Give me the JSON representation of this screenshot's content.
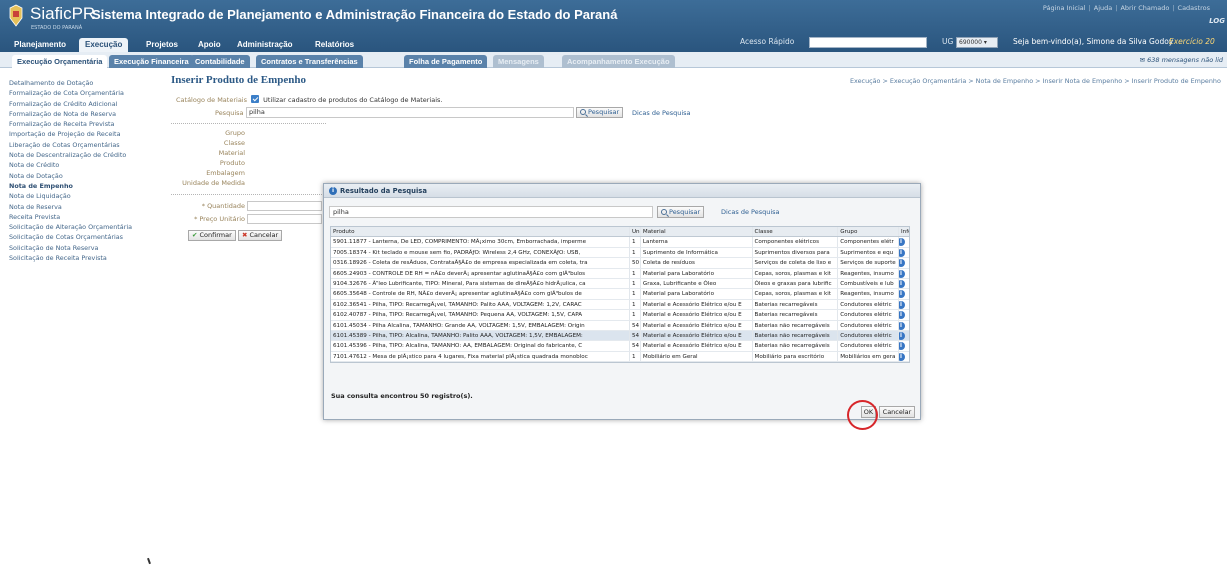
{
  "header": {
    "brand": "SiaficPR",
    "brand_sub": "ESTADO DO PARANÁ",
    "system_title": "Sistema Integrado de Planejamento e Administração Financeira do Estado do Paraná",
    "top_links": [
      "Página Inicial",
      "Ajuda",
      "Abrir Chamado",
      "Cadastros"
    ],
    "corner_logo": "LOG",
    "quick_access_label": "Acesso Rápido",
    "ug_label": "UG",
    "ug_value": "690000",
    "welcome": "Seja bem-vindo(a), Simone da Silva Godoy",
    "exercise": "Exercício 20"
  },
  "menu": {
    "items": [
      "Planejamento",
      "Execução",
      "Projetos",
      "Apoio",
      "Administração",
      "Relatórios"
    ]
  },
  "submenu": {
    "items": [
      "Execução Orçamentária",
      "Execução Financeira",
      "Contabilidade",
      "Contratos e Transferências",
      "Folha de Pagamento",
      "Mensagens",
      "Acompanhamento Execução"
    ],
    "messages": "638 mensagens não lid"
  },
  "sidebar": {
    "items": [
      "Detalhamento de Dotação",
      "Formalização de Cota Orçamentária",
      "Formalização de Crédito Adicional",
      "Formalização de Nota de Reserva",
      "Formalização de Receita Prevista",
      "Importação de Projeção de Receita",
      "Liberação de Cotas Orçamentárias",
      "Nota de Descentralização de Crédito",
      "Nota de Crédito",
      "Nota de Dotação",
      "Nota de Empenho",
      "Nota de Liquidação",
      "Nota de Reserva",
      "Receita Prevista",
      "Solicitação de Alteração Orçamentária",
      "Solicitação de Cotas Orçamentárias",
      "Solicitação de Nota Reserva",
      "Solicitação de Receita Prevista"
    ]
  },
  "main": {
    "title": "Inserir Produto de Empenho",
    "breadcrumb": "Execução > Execução Orçamentária > Nota de Empenho > Inserir Nota de Empenho > Inserir Produto de Empenho",
    "catalog_label": "Catálogo de Materiais",
    "catalog_text": "Utilizar cadastro de produtos do Catálogo de Materiais.",
    "search_label": "Pesquisa",
    "search_value": "pilha",
    "search_button": "Pesquisar",
    "search_tips": "Dicas de Pesquisa",
    "fields": [
      "Grupo",
      "Classe",
      "Material",
      "Produto",
      "Embalagem",
      "Unidade de Medida"
    ],
    "quantity_label": "* Quantidade",
    "unit_price_label": "* Preço Unitário",
    "confirm": "Confirmar",
    "cancel": "Cancelar"
  },
  "modal": {
    "title": "Resultado da Pesquisa",
    "search_value": "pilha",
    "search_button": "Pesquisar",
    "search_tips": "Dicas de Pesquisa",
    "columns": [
      "Produto",
      "Und.",
      "Material",
      "Classe",
      "Grupo",
      "Info"
    ],
    "rows": [
      [
        "5901.11877 - Lanterna, De LED, COMPRIMENTO: MÃ¡ximo 30cm, Emborrachada, imperme",
        "1",
        "Lanterna",
        "Componentes elétricos",
        "Componentes elétr"
      ],
      [
        "7005.18374 - Kit teclado e mouse sem fio, PADRÃƒO: Wireless 2,4 GHz, CONEXÃƒO: USB,",
        "1",
        "Suprimento de Informática",
        "Suprimentos diversos para",
        "Suprimentos e equ"
      ],
      [
        "0316.18926 - Coleta de resÃ­duos, ContrataÃ§Ã£o de empresa especializada em coleta, tra",
        "50",
        "Coleta de resíduos",
        "Serviços de coleta de lixo e",
        "Serviços de suporte"
      ],
      [
        "6605.24903 - CONTROLE DE RH = nÃ£o deverÃ¡ apresentar aglutinaÃ§Ã£o com glÃ³bulos",
        "1",
        "Material para Laboratório",
        "Cepas, soros, plasmas e kit",
        "Reagentes, insumo"
      ],
      [
        "9104.32676 - Ã“leo Lubrificante, TIPO: Mineral, Para sistemas de direÃ§Ã£o hidrÃ¡ulica, ca",
        "1",
        "Graxa, Lubrificante e Óleo",
        "Óleos e graxas para lubrific",
        "Combustíveis e lub"
      ],
      [
        "6605.35648 - Controle de RH, NÃ£o deverÃ¡ apresentar aglutinaÃ§Ã£o com glÃ³bulos de",
        "1",
        "Material para Laboratório",
        "Cepas, soros, plasmas e kit",
        "Reagentes, insumo"
      ],
      [
        "6102.36541 - Pilha, TIPO: RecarregÃ¡vel, TAMANHO: Palito AAA, VOLTAGEM: 1,2V, CARAC",
        "1",
        "Material e Acessório Elétrico e/ou E",
        "Baterias recarregáveis",
        "Condutores elétric"
      ],
      [
        "6102.40787 - Pilha, TIPO: RecarregÃ¡vel, TAMANHO: Pequena AA, VOLTAGEM: 1,5V, CAPA",
        "1",
        "Material e Acessório Elétrico e/ou E",
        "Baterias recarregáveis",
        "Condutores elétric"
      ],
      [
        "6101.45034 - Pilha Alcalina, TAMANHO: Grande AA, VOLTAGEM: 1,5V, EMBALAGEM: Origin",
        "54",
        "Material e Acessório Elétrico e/ou E",
        "Baterias não recarregáveis",
        "Condutores elétric"
      ],
      [
        "6101.45389 - Pilha, TIPO: Alcalina, TAMANHO: Palito AAA, VOLTAGEM: 1,5V, EMBALAGEM:",
        "54",
        "Material e Acessório Elétrico e/ou E",
        "Baterias não recarregáveis",
        "Condutores elétric"
      ],
      [
        "6101.45396 - Pilha, TIPO: Alcalina, TAMANHO: AA, EMBALAGEM: Original do fabricante, C",
        "54",
        "Material e Acessório Elétrico e/ou E",
        "Baterias não recarregáveis",
        "Condutores elétric"
      ],
      [
        "7101.47612 - Mesa de plÃ¡stico para 4 lugares, Fixa material plÃ¡stica quadrada monobloc",
        "1",
        "Mobiliário em Geral",
        "Mobiliário para escritório",
        "Mobiliários em gera"
      ]
    ],
    "selected_row": 9,
    "count_text": "Sua consulta encontrou 50 registro(s).",
    "ok": "OK",
    "cancel": "Cancelar"
  },
  "colors": {
    "header": "#2f5b86",
    "highlight_ring": "#d7262a",
    "info_icon": "#3876c4"
  }
}
